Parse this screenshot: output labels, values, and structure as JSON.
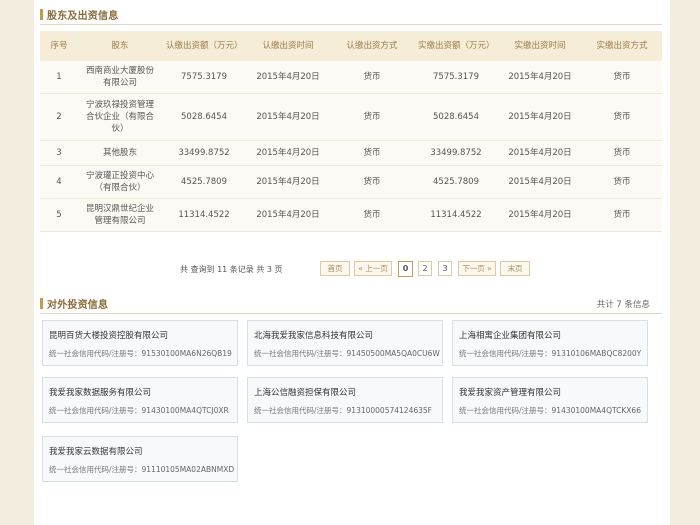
{
  "shareholders": {
    "title": "股东及出资信息",
    "columns": [
      "序号",
      "股东",
      "认缴出资额（万元）",
      "认缴出资时间",
      "认缴出资方式",
      "实缴出资额（万元）",
      "实缴出资时间",
      "实缴出资方式"
    ],
    "rows": [
      {
        "no": "1",
        "name": "西南商业大厦股份有限公司",
        "sub_amount": "7575.3179",
        "sub_date": "2015年4月20日",
        "sub_method": "货币",
        "paid_amount": "7575.3179",
        "paid_date": "2015年4月20日",
        "paid_method": "货币"
      },
      {
        "no": "2",
        "name": "宁波玖禄投资管理合伙企业（有限合伙）",
        "sub_amount": "5028.6454",
        "sub_date": "2015年4月20日",
        "sub_method": "货币",
        "paid_amount": "5028.6454",
        "paid_date": "2015年4月20日",
        "paid_method": "货币"
      },
      {
        "no": "3",
        "name": "其他股东",
        "sub_amount": "33499.8752",
        "sub_date": "2015年4月20日",
        "sub_method": "货币",
        "paid_amount": "33499.8752",
        "paid_date": "2015年4月20日",
        "paid_method": "货币"
      },
      {
        "no": "4",
        "name": "宁波瓘正投资中心（有限合伙）",
        "sub_amount": "4525.7809",
        "sub_date": "2015年4月20日",
        "sub_method": "货币",
        "paid_amount": "4525.7809",
        "paid_date": "2015年4月20日",
        "paid_method": "货币"
      },
      {
        "no": "5",
        "name": "昆明汉鼎世纪企业管理有限公司",
        "sub_amount": "11314.4522",
        "sub_date": "2015年4月20日",
        "sub_method": "货币",
        "paid_amount": "11314.4522",
        "paid_date": "2015年4月20日",
        "paid_method": "货币"
      }
    ],
    "pager": {
      "summary": "共 查询到 11 条记录 共 3 页",
      "first": "首页",
      "prev": "« 上一页",
      "pages": [
        "0",
        "2",
        "3"
      ],
      "next": "下一页 »",
      "last": "末页"
    }
  },
  "investments": {
    "title": "对外投资信息",
    "total": "共计 7 条信息",
    "code_label": "统一社会信用代码/注册号：",
    "items": [
      {
        "name": "昆明百货大楼投资控股有限公司",
        "code": "91530100MA6N26QB19"
      },
      {
        "name": "北海我爱我家信息科技有限公司",
        "code": "91450500MA5QA0CU6W"
      },
      {
        "name": "上海相寓企业集团有限公司",
        "code": "91310106MABQC8200Y"
      },
      {
        "name": "我爱我家数据服务有限公司",
        "code": "91430100MA4QTCJ0XR"
      },
      {
        "name": "上海公信融资担保有限公司",
        "code": "913100005741246​35F"
      },
      {
        "name": "我爱我家资产管理有限公司",
        "code": "91430100MA4QTCKX66"
      },
      {
        "name": "我爱我家云数据有限公司",
        "code": "91110105MA02ABNMXD"
      }
    ]
  }
}
